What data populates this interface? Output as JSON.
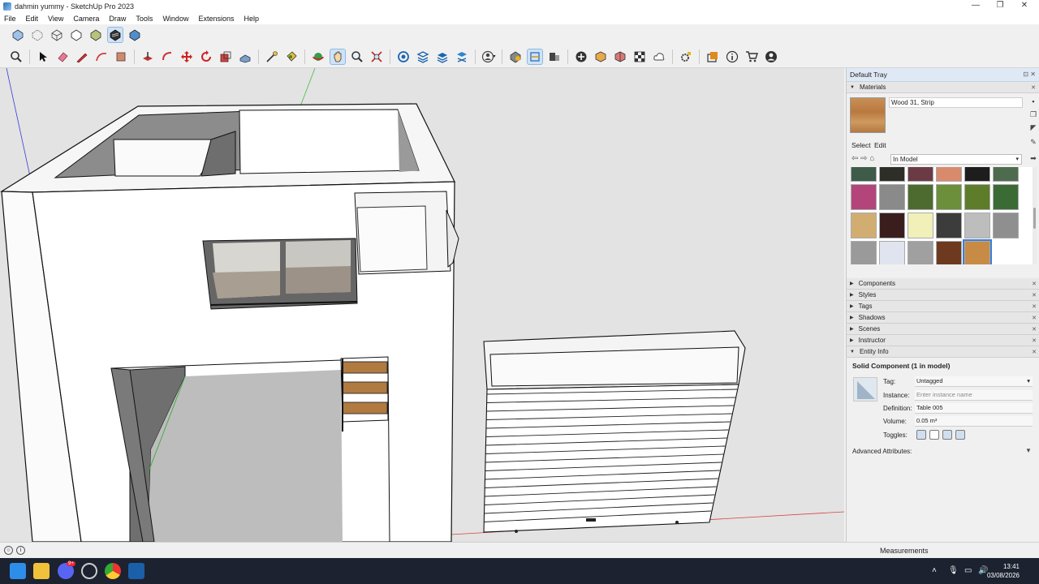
{
  "window": {
    "title": "dahmin yummy - SketchUp Pro 2023",
    "controls": [
      "—",
      "❐",
      "✕"
    ]
  },
  "menu": [
    "File",
    "Edit",
    "View",
    "Camera",
    "Draw",
    "Tools",
    "Window",
    "Extensions",
    "Help"
  ],
  "tray": {
    "title": "Default Tray",
    "materials": {
      "header": "Materials",
      "current_name": "Wood 31, Strip",
      "tab_select": "Select",
      "tab_edit": "Edit",
      "library": "In Model"
    },
    "panels": [
      "Components",
      "Styles",
      "Tags",
      "Shadows",
      "Scenes",
      "Instructor",
      "Entity Info"
    ],
    "entity_info": {
      "title": "Solid Component (1 in model)",
      "tag_label": "Tag:",
      "tag_value": "Untagged",
      "instance_label": "Instance:",
      "instance_placeholder": "Enter instance name",
      "definition_label": "Definition:",
      "definition_value": "Table 005",
      "volume_label": "Volume:",
      "volume_value": "0.05 m³",
      "toggles_label": "Toggles:",
      "advanced_label": "Advanced Attributes:"
    }
  },
  "status": {
    "measurements_label": "Measurements"
  },
  "taskbar": {
    "time": "13:41",
    "date": "03/08/2026",
    "badge": "9+"
  },
  "colors": {
    "viewport_bg": "#e3e3e3",
    "tray_header": "#dfe9f5",
    "selected_outline": "#3b7fd6",
    "taskbar": "#1c2230"
  }
}
